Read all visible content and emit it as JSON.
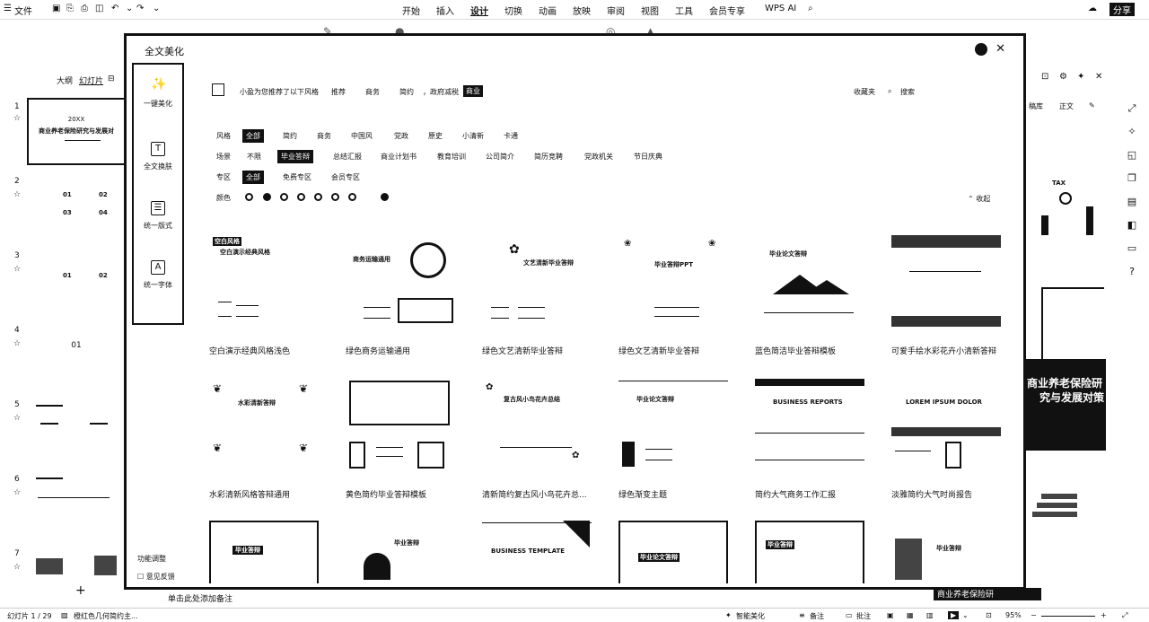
{
  "menubar": {
    "file": "文件",
    "tabs": [
      "开始",
      "插入",
      "设计",
      "切换",
      "动画",
      "放映",
      "审阅",
      "视图",
      "工具",
      "会员专享"
    ],
    "active_tab": "设计",
    "wps_ai": "WPS AI",
    "share": "分享"
  },
  "slide_panel": {
    "tab_outline": "大纲",
    "tab_slides": "幻灯片",
    "slides": [
      {
        "num": "1",
        "title": "20XX",
        "subtitle": "商业养老保险研究与发展对"
      },
      {
        "num": "2",
        "title": "",
        "subtitle": ""
      },
      {
        "num": "3",
        "title": "",
        "subtitle": ""
      },
      {
        "num": "4",
        "title": "01",
        "subtitle": ""
      },
      {
        "num": "5",
        "title": "",
        "subtitle": ""
      },
      {
        "num": "6",
        "title": "",
        "subtitle": ""
      },
      {
        "num": "7",
        "title": "",
        "subtitle": ""
      }
    ],
    "add_icon": "plus-icon"
  },
  "right_panel": {
    "tab_a": "稿库",
    "tab_b": "正文",
    "banner_line1": "商业养老保险研",
    "banner_line2": "究与发展对策",
    "tax": "TAX",
    "bottom_text": "商业养老保险研"
  },
  "modal": {
    "title": "全文美化",
    "sidebar": [
      {
        "label": "一键美化",
        "icon": "magic-wand-icon"
      },
      {
        "label": "全文换肤",
        "icon": "tshirt-icon"
      },
      {
        "label": "统一版式",
        "icon": "layout-icon"
      },
      {
        "label": "统一字体",
        "icon": "font-icon"
      }
    ],
    "footer_links": [
      "功能调整",
      "意见反馈"
    ],
    "recommend": {
      "text": "小盈为您推荐了以下风格",
      "chips": [
        "推荐",
        "商务",
        "简约",
        "，政府减税"
      ],
      "active_chip": "商业",
      "favorites": "收藏夹",
      "search": "搜索"
    },
    "filters": {
      "style_label": "风格",
      "style": [
        "全部",
        "简约",
        "商务",
        "中国风",
        "党政",
        "原史",
        "小清新",
        "卡通"
      ],
      "style_active": "全部",
      "scene_label": "场景",
      "scene": [
        "不限",
        "毕业答辩",
        "总结汇报",
        "商业计划书",
        "教育培训",
        "公司简介",
        "简历竞聘",
        "党政机关",
        "节日庆典"
      ],
      "scene_active": "毕业答辩",
      "zone_label": "专区",
      "zone": [
        "全部",
        "免费专区",
        "会员专区"
      ],
      "zone_active": "全部",
      "color_label": "颜色",
      "collapse": "收起"
    },
    "templates": [
      {
        "caption": "空白演示经典风格浅色",
        "head": "空白演示经典风格",
        "badge": "空白风格"
      },
      {
        "caption": "绿色商务运输通用",
        "head": "商务运输通用"
      },
      {
        "caption": "绿色文艺清新毕业答辩",
        "head": "文艺清新毕业答辩"
      },
      {
        "caption": "绿色文艺清新毕业答辩",
        "head": "毕业答辩PPT"
      },
      {
        "caption": "蓝色简洁毕业答辩模板",
        "head": "毕业论文答辩"
      },
      {
        "caption": "可爱手绘水彩花卉小清新答辩",
        "head": ""
      },
      {
        "caption": "水彩清新风格答辩通用",
        "head": "水彩清新答辩"
      },
      {
        "caption": "黄色简约毕业答辩模板",
        "head": ""
      },
      {
        "caption": "清新简约复古风小鸟花卉总...",
        "head": "复古风小鸟花卉总结"
      },
      {
        "caption": "绿色渐变主题",
        "head": "毕业论文答辩"
      },
      {
        "caption": "简约大气商务工作汇报",
        "head": "BUSINESS REPORTS"
      },
      {
        "caption": "淡雅简约大气时尚报告",
        "head": "LOREM IPSUM DOLOR"
      },
      {
        "caption": "",
        "head": "毕业答辩"
      },
      {
        "caption": "",
        "head": "毕业答辩"
      },
      {
        "caption": "",
        "head": "BUSINESS TEMPLATE"
      },
      {
        "caption": "",
        "head": "毕业论文答辩"
      },
      {
        "caption": "",
        "head": "毕业答辩"
      },
      {
        "caption": "",
        "head": "毕业答辩"
      }
    ]
  },
  "notes_placeholder": "单击此处添加备注",
  "status": {
    "slide_count": "幻灯片 1 / 29",
    "theme": "橙红色几何简约主...",
    "smart_beautify": "智能美化",
    "notes": "备注",
    "comments": "批注",
    "zoom": "95%"
  }
}
